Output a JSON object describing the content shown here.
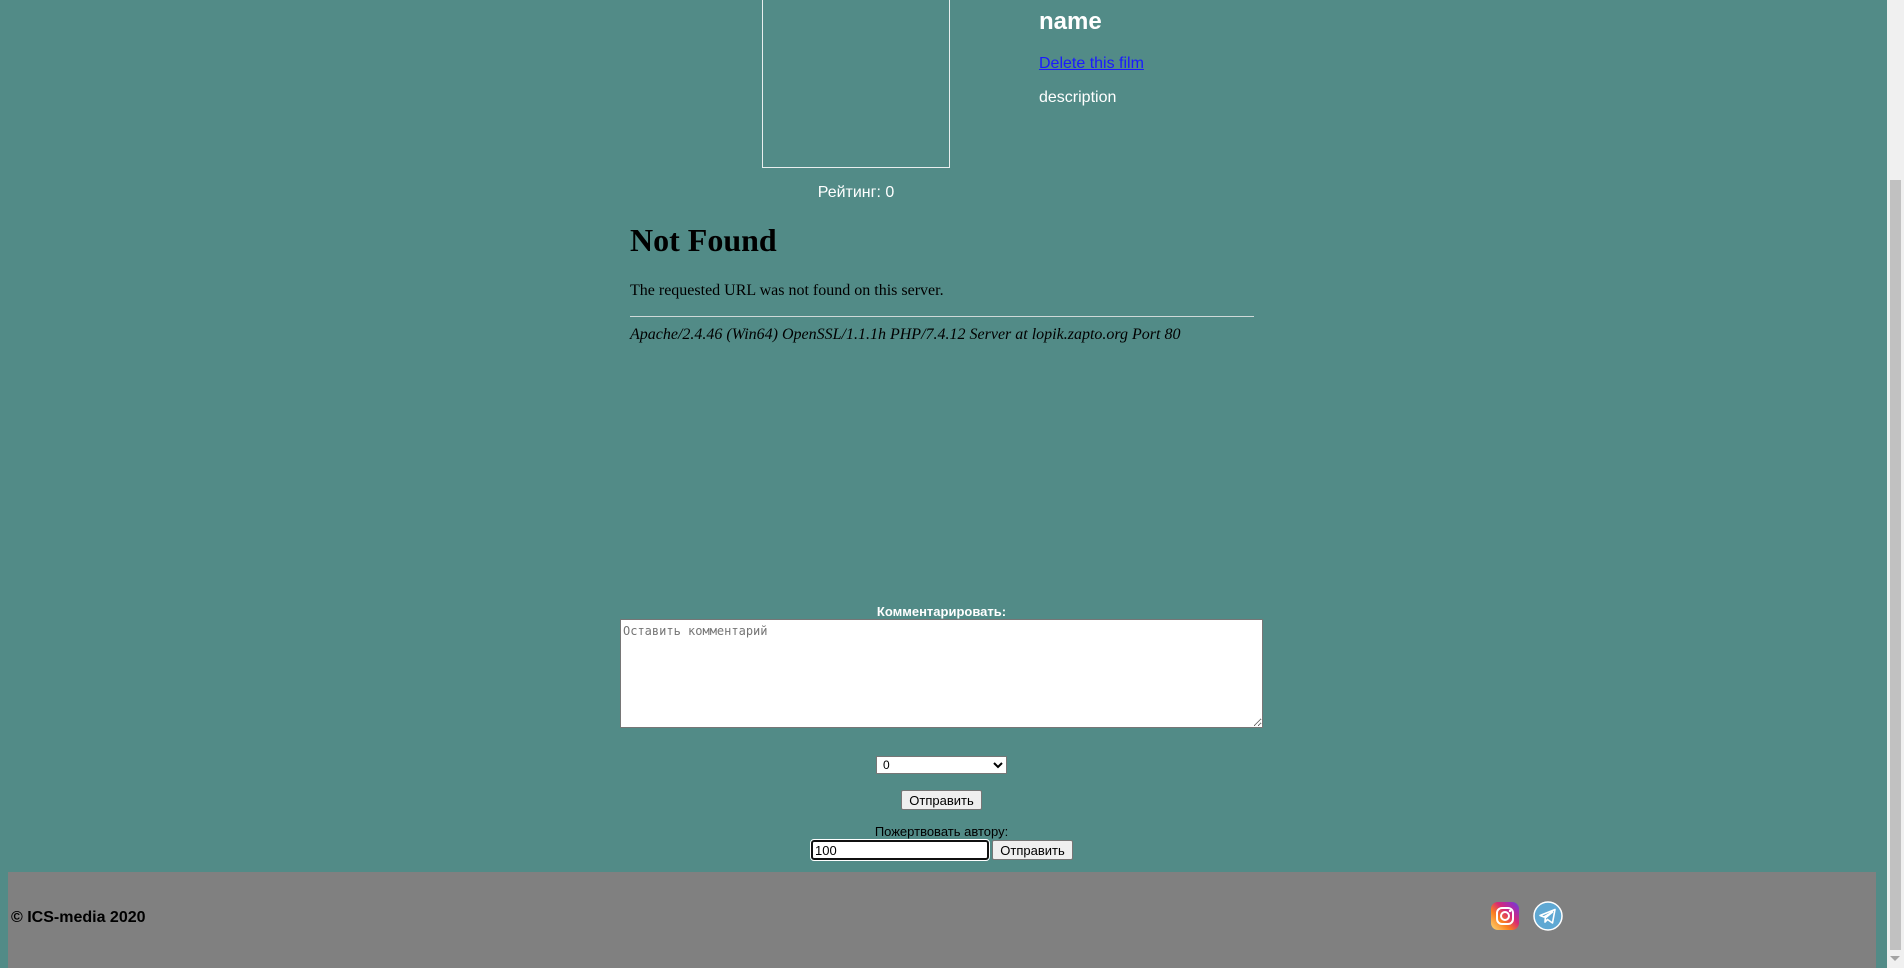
{
  "film": {
    "name": "name",
    "delete_link": "Delete this film",
    "description": "description",
    "rating": "Рейтинг: 0"
  },
  "error_page": {
    "title": "Not Found",
    "message": "The requested URL was not found on this server.",
    "server_signature": "Apache/2.4.46 (Win64) OpenSSL/1.1.1h PHP/7.4.12 Server at lopik.zapto.org Port 80"
  },
  "comment_form": {
    "label": "Комментарировать:",
    "placeholder": "Оставить комментарий",
    "rating_selected": "0",
    "submit_label": "Отправить"
  },
  "donate_form": {
    "label": "Пожертвовать автору:",
    "amount_value": "100",
    "submit_label": "Отправить"
  },
  "footer": {
    "copyright": "© ICS-media 2020",
    "social_icons": [
      "instagram-icon",
      "telegram-icon"
    ]
  },
  "colors": {
    "page_background": "#528b87",
    "footer_background": "#808080",
    "link": "#1a1aff"
  }
}
